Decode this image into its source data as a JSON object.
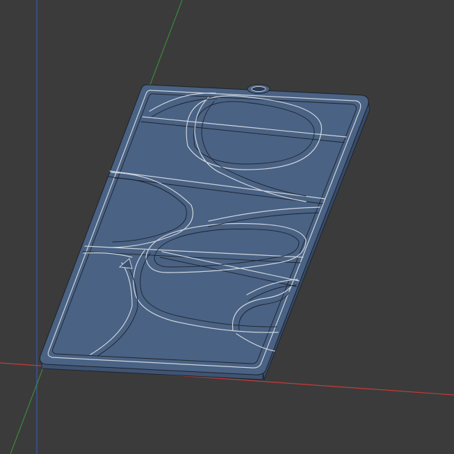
{
  "viewport": {
    "background_color": "#3b3b3b",
    "model_face_color": "#4a6283",
    "model_edge_color": "#1c222c",
    "model_highlight_color": "#cfd6e0",
    "axes": {
      "x_color": "#c83a3a",
      "y_color": "#3a9a3a",
      "z_color": "#3a5cc8"
    }
  }
}
